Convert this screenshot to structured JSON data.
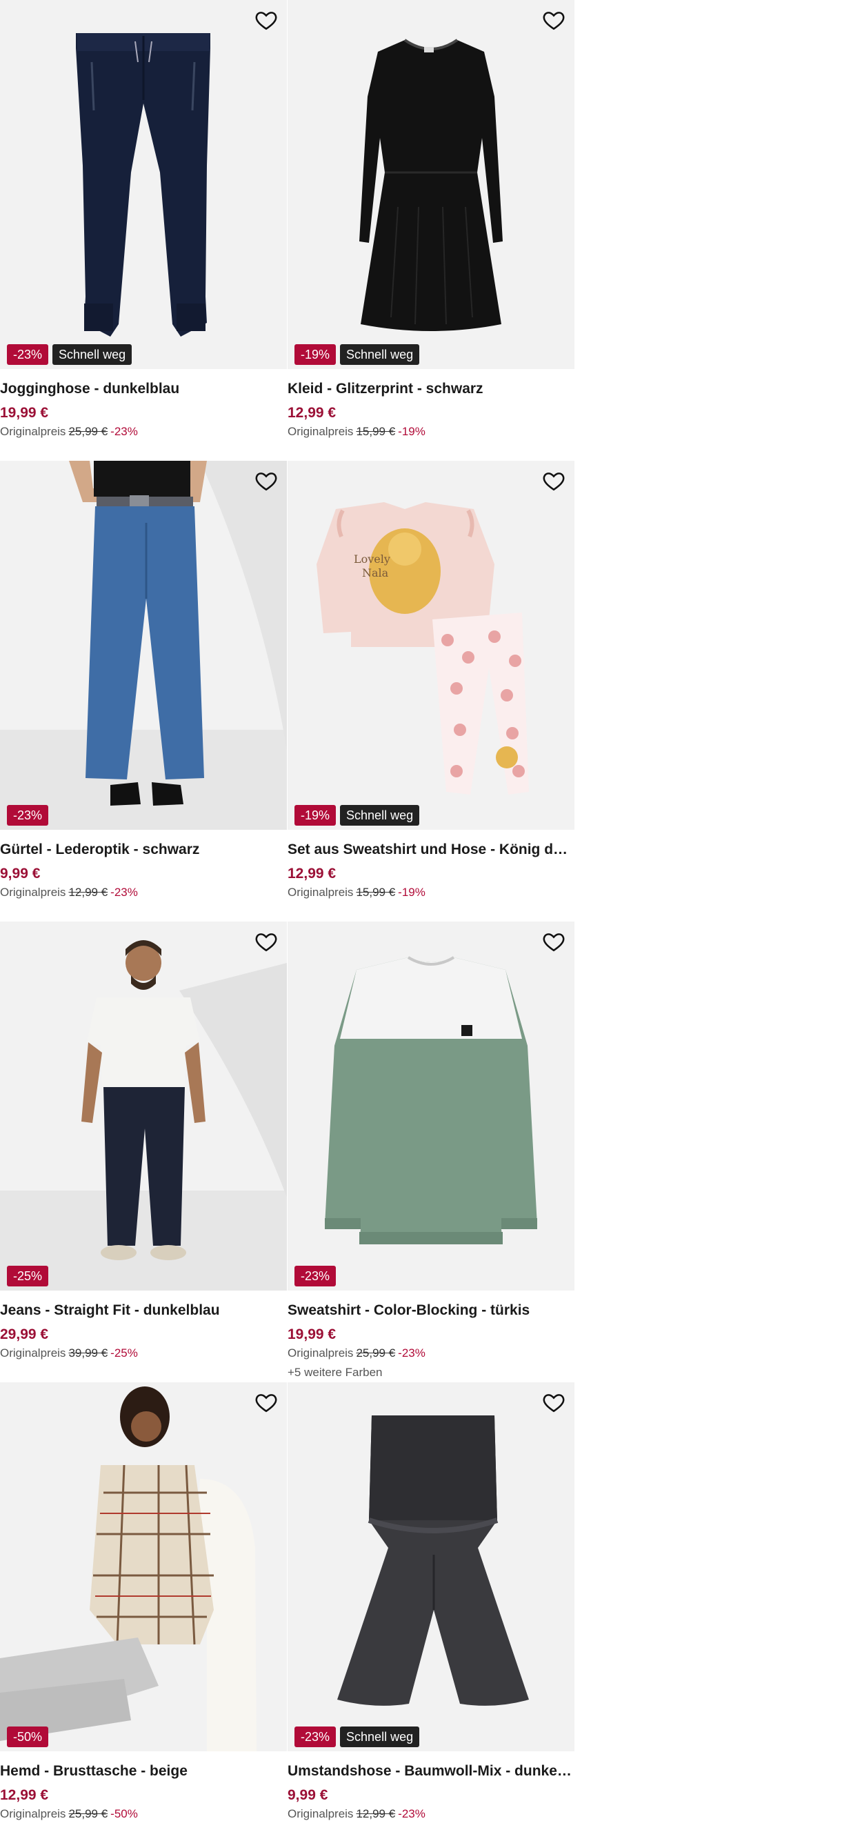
{
  "colors": {
    "sale_badge": "#b10b38",
    "fast_badge": "#222222",
    "price": "#9b1036",
    "image_bg": "#f2f2f2"
  },
  "products": [
    {
      "title": "Jogginghose - dunkelblau",
      "price": "19,99 €",
      "original_label": "Originalpreis",
      "original_price": "25,99 €",
      "discount": "-23%",
      "badge_discount": "-23%",
      "badge_fast": "Schnell weg",
      "more_colors": ""
    },
    {
      "title": "Kleid - Glitzerprint - schwarz",
      "price": "12,99 €",
      "original_label": "Originalpreis",
      "original_price": "15,99 €",
      "discount": "-19%",
      "badge_discount": "-19%",
      "badge_fast": "Schnell weg",
      "more_colors": ""
    },
    {
      "title": "Gürtel - Lederoptik - schwarz",
      "price": "9,99 €",
      "original_label": "Originalpreis",
      "original_price": "12,99 €",
      "discount": "-23%",
      "badge_discount": "-23%",
      "badge_fast": "",
      "more_colors": ""
    },
    {
      "title": "Set aus Sweatshirt und Hose - König der Lö...",
      "price": "12,99 €",
      "original_label": "Originalpreis",
      "original_price": "15,99 €",
      "discount": "-19%",
      "badge_discount": "-19%",
      "badge_fast": "Schnell weg",
      "more_colors": ""
    },
    {
      "title": "Jeans - Straight Fit - dunkelblau",
      "price": "29,99 €",
      "original_label": "Originalpreis",
      "original_price": "39,99 €",
      "discount": "-25%",
      "badge_discount": "-25%",
      "badge_fast": "",
      "more_colors": ""
    },
    {
      "title": "Sweatshirt - Color-Blocking - türkis",
      "price": "19,99 €",
      "original_label": "Originalpreis",
      "original_price": "25,99 €",
      "discount": "-23%",
      "badge_discount": "-23%",
      "badge_fast": "",
      "more_colors": "+5 weitere Farben"
    },
    {
      "title": "Hemd - Brusttasche - beige",
      "price": "12,99 €",
      "original_label": "Originalpreis",
      "original_price": "25,99 €",
      "discount": "-50%",
      "badge_discount": "-50%",
      "badge_fast": "",
      "more_colors": ""
    },
    {
      "title": "Umstandshose - Baumwoll-Mix - dunkelgrau",
      "price": "9,99 €",
      "original_label": "Originalpreis",
      "original_price": "12,99 €",
      "discount": "-23%",
      "badge_discount": "-23%",
      "badge_fast": "Schnell weg",
      "more_colors": ""
    }
  ],
  "illustration_text": {
    "set_print_line1": "Lovely",
    "set_print_line2": "Nala"
  }
}
